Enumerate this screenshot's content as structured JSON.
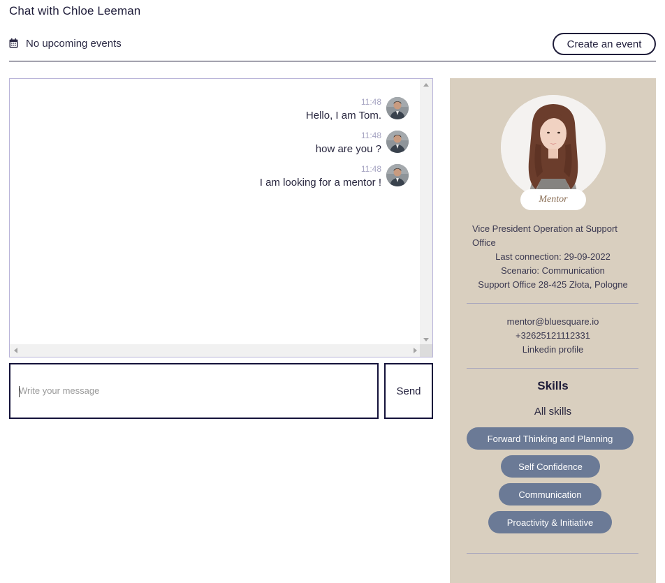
{
  "header": {
    "title": "Chat with Chloe Leeman",
    "events_text": "No upcoming events",
    "create_event_label": "Create an event"
  },
  "chat": {
    "messages": [
      {
        "time": "11:48",
        "text": "Hello, I am Tom."
      },
      {
        "time": "11:48",
        "text": "how are you ?"
      },
      {
        "time": "11:48",
        "text": "I am looking for a mentor !"
      }
    ],
    "input_placeholder": "Write your message",
    "send_label": "Send"
  },
  "profile": {
    "role": "Mentor",
    "job_title": "Vice President Operation at Support Office",
    "last_connection": "Last connection: 29-09-2022",
    "scenario": "Scenario: Communication",
    "location": "Support Office 28-425 Złota, Pologne",
    "email": "mentor@bluesquare.io",
    "phone": "+32625121112331",
    "linkedin": "Linkedin profile",
    "skills_title": "Skills",
    "all_skills_label": "All skills",
    "skills": [
      "Forward Thinking and Planning",
      "Self Confidence",
      "Communication",
      "Proactivity & Initiative"
    ]
  },
  "colors": {
    "accent": "#1f1d3a",
    "panel_bg": "#d9cfbf",
    "skill_pill": "#6b7a96"
  }
}
